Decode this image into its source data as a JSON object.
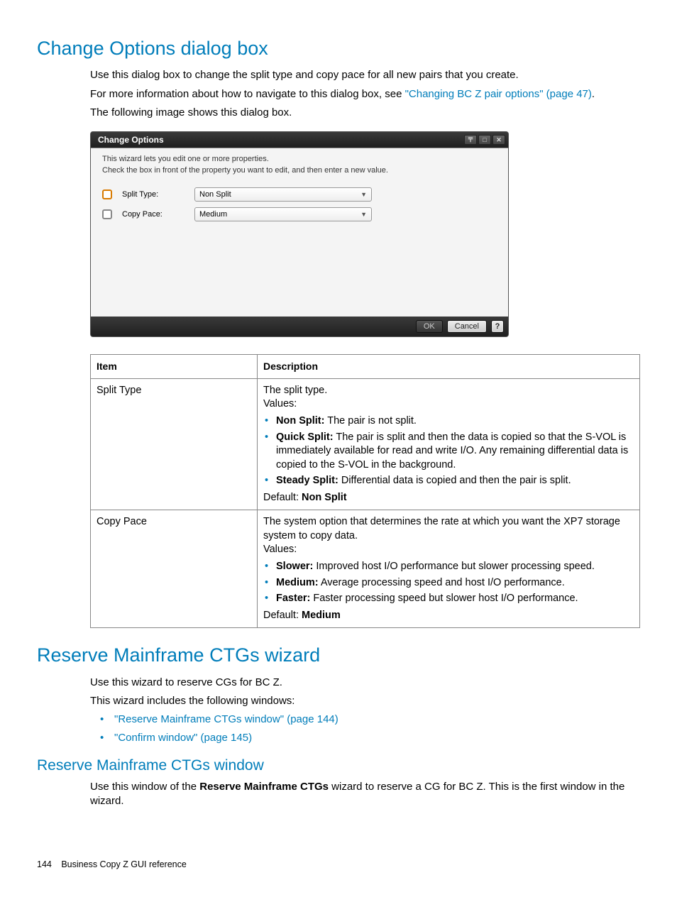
{
  "section1": {
    "heading": "Change Options dialog box",
    "p1": "Use this dialog box to change the split type and copy pace for all new pairs that you create.",
    "p2a": "For more information about how to navigate to this dialog box, see ",
    "p2link": "\"Changing BC Z pair options\" (page 47)",
    "p2b": ".",
    "p3": "The following image shows this dialog box."
  },
  "dialog": {
    "title": "Change Options",
    "intro1": "This wizard lets you edit one or more properties.",
    "intro2": "Check the box in front of the property you want to edit, and then enter a new value.",
    "row1_label": "Split Type:",
    "row1_value": "Non Split",
    "row2_label": "Copy Pace:",
    "row2_value": "Medium",
    "ok": "OK",
    "cancel": "Cancel",
    "help": "?"
  },
  "table": {
    "h1": "Item",
    "h2": "Description",
    "r1_item": "Split Type",
    "r1_p1": "The split type.",
    "r1_p2": "Values:",
    "r1_v1b": "Non Split:",
    "r1_v1t": " The pair is not split.",
    "r1_v2b": "Quick Split:",
    "r1_v2t": " The pair is split and then the data is copied so that the S-VOL is immediately available for read and write I/O. Any remaining differential data is copied to the S-VOL in the background.",
    "r1_v3b": "Steady Split:",
    "r1_v3t": " Differential data is copied and then the pair is split.",
    "r1_def_label": "Default: ",
    "r1_def_val": "Non Split",
    "r2_item": "Copy Pace",
    "r2_p1": "The system option that determines the rate at which you want the XP7 storage system to copy data.",
    "r2_p2": "Values:",
    "r2_v1b": "Slower:",
    "r2_v1t": " Improved host I/O performance but slower processing speed.",
    "r2_v2b": "Medium:",
    "r2_v2t": " Average processing speed and host I/O performance.",
    "r2_v3b": "Faster:",
    "r2_v3t": " Faster processing speed but slower host I/O performance.",
    "r2_def_label": "Default: ",
    "r2_def_val": "Medium"
  },
  "section2": {
    "heading": "Reserve Mainframe CTGs wizard",
    "p1": "Use this wizard to reserve CGs for BC Z.",
    "p2": "This wizard includes the following windows:",
    "li1": "\"Reserve Mainframe CTGs window\" (page 144)",
    "li2": "\"Confirm window\" (page 145)"
  },
  "section3": {
    "heading": "Reserve Mainframe CTGs window",
    "p1a": "Use this window of the ",
    "p1b": "Reserve Mainframe CTGs",
    "p1c": " wizard to reserve a CG for BC Z. This is the first window in the wizard."
  },
  "footer": {
    "page": "144",
    "title": "Business Copy Z GUI reference"
  }
}
